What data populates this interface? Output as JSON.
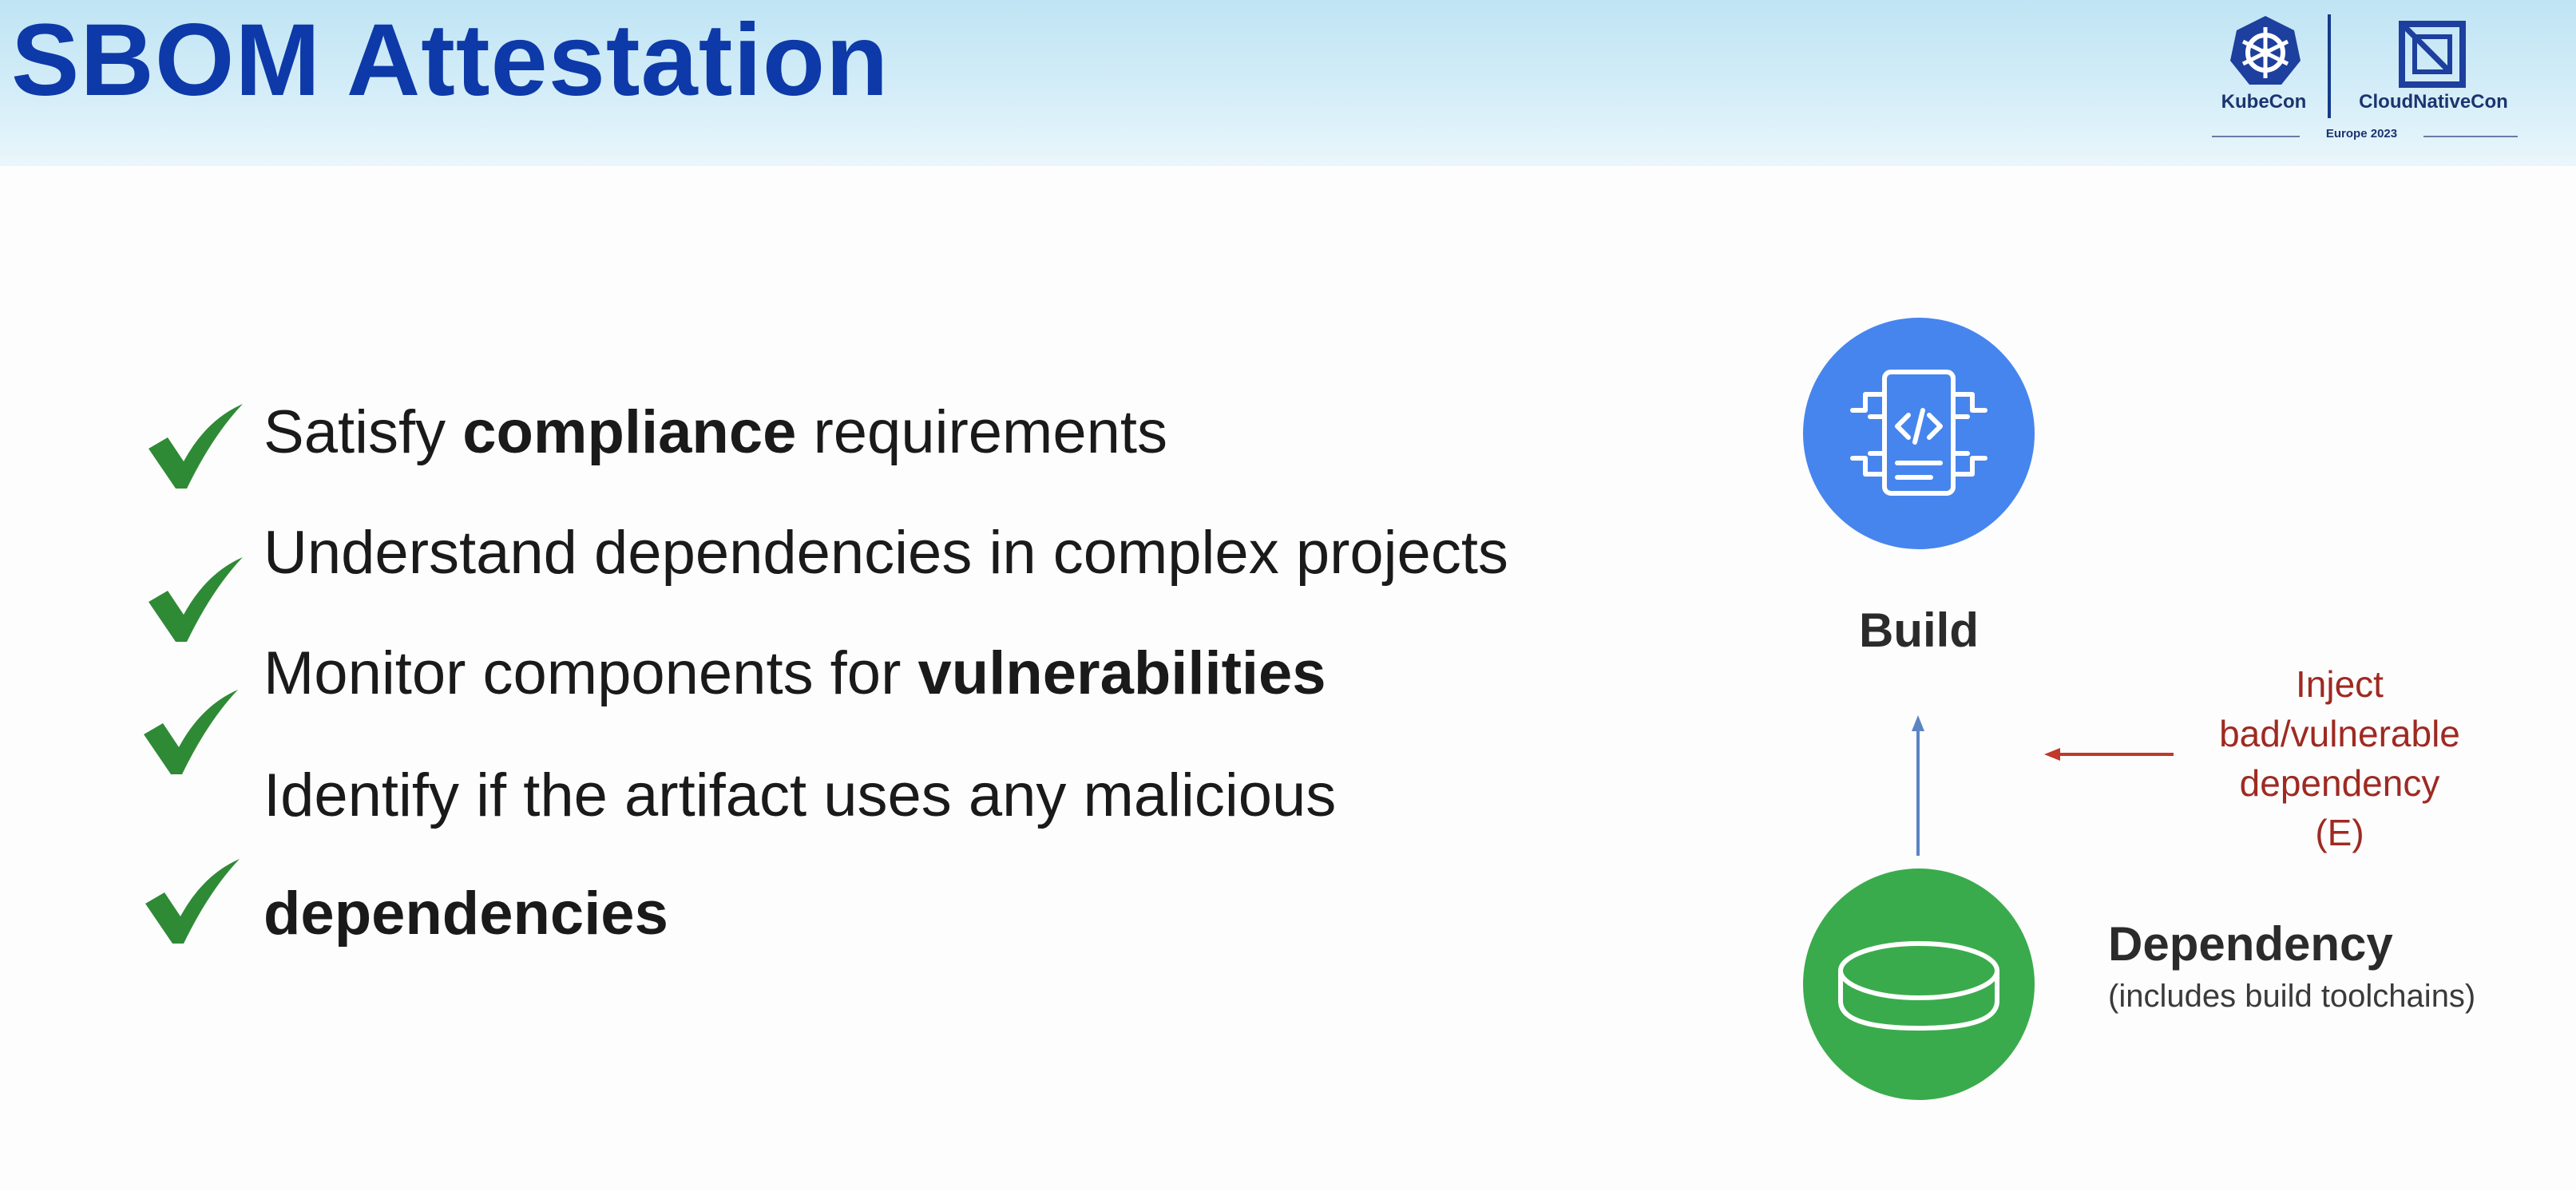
{
  "slide": {
    "title": "SBOM Attestation",
    "logo": {
      "left_name": "KubeCon",
      "right_name": "CloudNativeCon",
      "edition": "Europe 2023",
      "left_icon": "kubernetes-helm-icon",
      "right_icon": "cncf-icon"
    },
    "bullets": [
      {
        "icon": "checkmark-icon",
        "before": "Satisfy ",
        "bold": "compliance",
        "after": " requirements"
      },
      {
        "icon": "checkmark-icon",
        "before": "Understand dependencies in complex projects",
        "bold": "",
        "after": ""
      },
      {
        "icon": "checkmark-icon",
        "before": "Monitor components for ",
        "bold": "vulnerabilities",
        "after": ""
      },
      {
        "icon": null,
        "before": "Identify if the artifact uses any malicious",
        "bold": "",
        "after": ""
      },
      {
        "icon": "checkmark-icon",
        "before": "",
        "bold": "dependencies",
        "after": ""
      }
    ],
    "diagram": {
      "build": {
        "label": "Build",
        "icon": "code-document-icon"
      },
      "dependency": {
        "label": "Dependency",
        "sublabel": "(includes build toolchains)",
        "icon": "database-disk-icon"
      },
      "inject": {
        "lines": [
          "Inject",
          "bad/vulnerable",
          "dependency",
          "(E)"
        ]
      }
    },
    "colors": {
      "title": "#0d3aa8",
      "check": "#2f8a36",
      "build_node": "#4785ee",
      "dependency_node": "#3aab4c",
      "inject_text": "#9e2a22",
      "arrow_up": "#5b84c4",
      "arrow_inject": "#c0392b"
    }
  }
}
